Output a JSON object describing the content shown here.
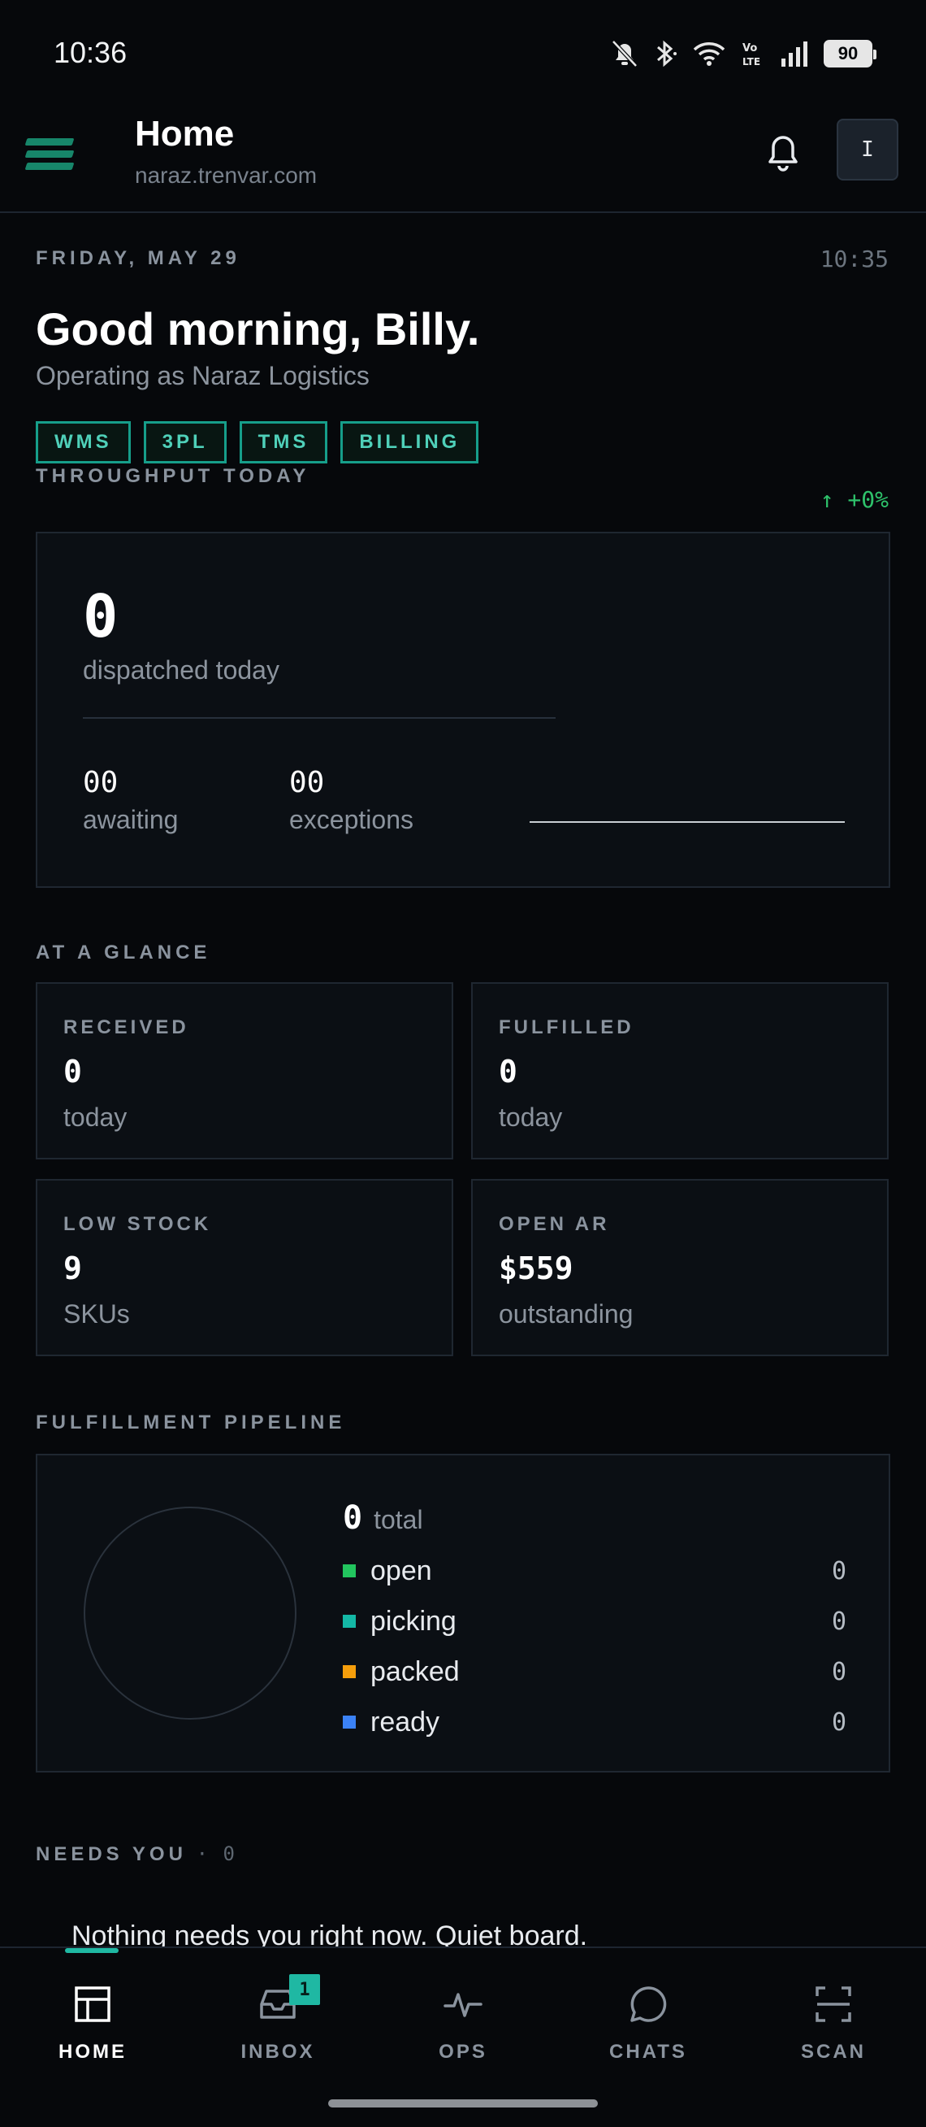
{
  "status_bar": {
    "time": "10:36",
    "battery": "90"
  },
  "header": {
    "title": "Home",
    "subtitle": "naraz.trenvar.com",
    "avatar_initial": "I"
  },
  "home": {
    "date": "FRIDAY, MAY 29",
    "clock": "10:35",
    "greeting": "Good morning, Billy.",
    "operating_as": "Operating as Naraz Logistics",
    "modules": [
      "WMS",
      "3PL",
      "TMS",
      "BILLING"
    ]
  },
  "throughput": {
    "label": "THROUGHPUT TODAY",
    "trend": "↑ +0%",
    "dispatched": "0",
    "dispatched_label": "dispatched today",
    "awaiting": "00",
    "awaiting_label": "awaiting",
    "exceptions": "00",
    "exceptions_label": "exceptions"
  },
  "glance": {
    "label": "AT A GLANCE",
    "cards": [
      {
        "title": "RECEIVED",
        "value": "0",
        "sub": "today"
      },
      {
        "title": "FULFILLED",
        "value": "0",
        "sub": "today"
      },
      {
        "title": "LOW STOCK",
        "value": "9",
        "sub": "SKUs"
      },
      {
        "title": "OPEN AR",
        "value": "$559",
        "sub": "outstanding"
      }
    ]
  },
  "pipeline": {
    "label": "FULFILLMENT PIPELINE",
    "total": "0",
    "total_label": "total",
    "stages": [
      {
        "label": "open",
        "value": "0",
        "color": "#22c55e"
      },
      {
        "label": "picking",
        "value": "0",
        "color": "#14b8a6"
      },
      {
        "label": "packed",
        "value": "0",
        "color": "#f59e0b"
      },
      {
        "label": "ready",
        "value": "0",
        "color": "#3b82f6"
      }
    ]
  },
  "needs_you": {
    "label": "NEEDS YOU",
    "count": "· 0",
    "empty_text": "Nothing needs you right now. Quiet board."
  },
  "nav": {
    "items": [
      {
        "label": "HOME",
        "icon": "home-grid-icon"
      },
      {
        "label": "INBOX",
        "icon": "inbox-icon",
        "badge": "1"
      },
      {
        "label": "OPS",
        "icon": "pulse-icon"
      },
      {
        "label": "CHATS",
        "icon": "chat-bubble-icon"
      },
      {
        "label": "SCAN",
        "icon": "scan-frame-icon"
      }
    ]
  },
  "colors": {
    "accent": "#1fb8a3",
    "background": "#06080b",
    "card": "#0b0f14",
    "positive": "#2ec26b"
  }
}
